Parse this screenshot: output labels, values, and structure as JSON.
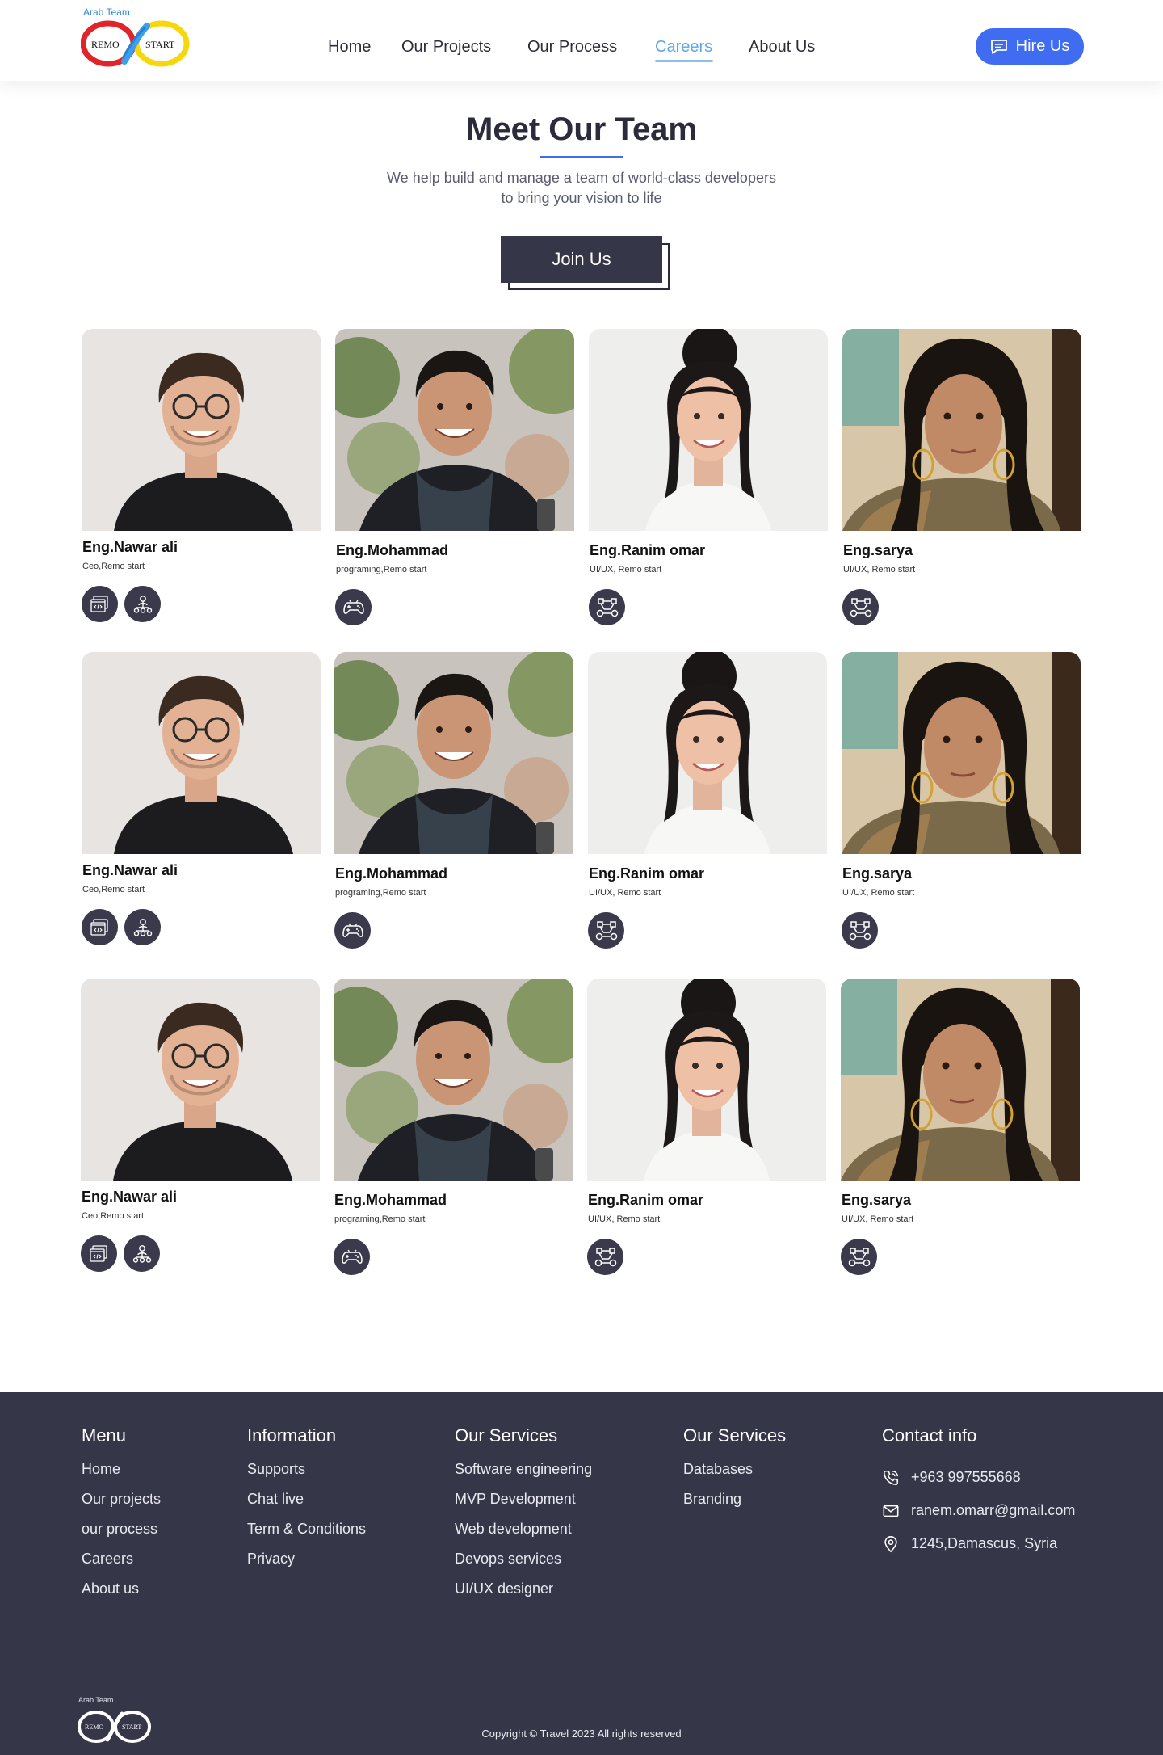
{
  "header": {
    "logo_top_text": "Arab Team",
    "logo_left_word": "REMO",
    "logo_right_word": "START",
    "nav": [
      {
        "label": "Home",
        "active": false
      },
      {
        "label": "Our Projects",
        "active": false
      },
      {
        "label": "Our Process",
        "active": false
      },
      {
        "label": "Careers",
        "active": true
      },
      {
        "label": "About Us",
        "active": false
      }
    ],
    "hire_label": "Hire Us",
    "hire_icon": "chat-icon"
  },
  "hero": {
    "title": "Meet Our Team",
    "subtitle_line1": "We help build and manage a team of world-class developers",
    "subtitle_line2": "to bring your vision to life",
    "join_label": "Join Us"
  },
  "team": [
    {
      "name": "Eng.Nawar ali",
      "role": "Ceo,Remo start",
      "skills": [
        "code-window-icon",
        "hierarchy-icon"
      ],
      "photo": "man-glasses-photo"
    },
    {
      "name": "Eng.Mohammad",
      "role": "programing,Remo start",
      "skills": [
        "gamepad-icon"
      ],
      "photo": "man-scarf-photo"
    },
    {
      "name": "Eng.Ranim omar",
      "role": "UI/UX, Remo start",
      "skills": [
        "vector-nodes-icon"
      ],
      "photo": "woman-bun-photo"
    },
    {
      "name": "Eng.sarya",
      "role": "UI/UX, Remo start",
      "skills": [
        "vector-nodes-icon"
      ],
      "photo": "woman-earrings-photo"
    },
    {
      "name": "Eng.Nawar ali",
      "role": "Ceo,Remo start",
      "skills": [
        "code-window-icon",
        "hierarchy-icon"
      ],
      "photo": "man-glasses-photo"
    },
    {
      "name": "Eng.Mohammad",
      "role": "programing,Remo start",
      "skills": [
        "gamepad-icon"
      ],
      "photo": "man-scarf-photo"
    },
    {
      "name": "Eng.Ranim omar",
      "role": "UI/UX, Remo start",
      "skills": [
        "vector-nodes-icon"
      ],
      "photo": "woman-bun-photo"
    },
    {
      "name": "Eng.sarya",
      "role": "UI/UX, Remo start",
      "skills": [
        "vector-nodes-icon"
      ],
      "photo": "woman-earrings-photo"
    },
    {
      "name": "Eng.Nawar ali",
      "role": "Ceo,Remo start",
      "skills": [
        "code-window-icon",
        "hierarchy-icon"
      ],
      "photo": "man-glasses-photo"
    },
    {
      "name": "Eng.Mohammad",
      "role": "programing,Remo start",
      "skills": [
        "gamepad-icon"
      ],
      "photo": "man-scarf-photo"
    },
    {
      "name": "Eng.Ranim omar",
      "role": "UI/UX, Remo start",
      "skills": [
        "vector-nodes-icon"
      ],
      "photo": "woman-bun-photo"
    },
    {
      "name": "Eng.sarya",
      "role": "UI/UX, Remo start",
      "skills": [
        "vector-nodes-icon"
      ],
      "photo": "woman-earrings-photo"
    }
  ],
  "footer": {
    "menu": {
      "heading": "Menu",
      "links": [
        "Home",
        "Our projects",
        "our process",
        "Careers",
        "About us"
      ]
    },
    "information": {
      "heading": "Information",
      "links": [
        "Supports",
        "Chat live",
        "Term & Conditions",
        "Privacy"
      ]
    },
    "services1": {
      "heading": "Our Services",
      "links": [
        "Software engineering",
        "MVP Development",
        "Web development",
        "Devops services",
        "UI/UX designer"
      ]
    },
    "services2": {
      "heading": "Our Services",
      "links": [
        "Databases",
        "Branding"
      ]
    },
    "contact": {
      "heading": "Contact info",
      "phone": "+963 997555668",
      "email": "ranem.omarr@gmail.com",
      "address": "1245,Damascus, Syria"
    },
    "logo_top_text": "Arab Team",
    "copyright": "Copyright © Travel 2023 All rights reserved"
  },
  "colors": {
    "accent": "#3f6cf0",
    "active_nav": "#5fa8e6",
    "dark": "#363649",
    "footer_bg": "#363649"
  }
}
